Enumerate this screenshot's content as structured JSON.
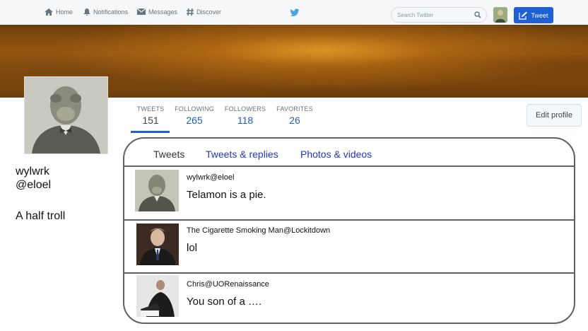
{
  "nav": {
    "items": [
      {
        "label": "Home",
        "icon": "home-icon"
      },
      {
        "label": "Notifications",
        "icon": "bell-icon"
      },
      {
        "label": "Messages",
        "icon": "envelope-icon"
      },
      {
        "label": "Discover",
        "icon": "hashtag-icon"
      }
    ],
    "logo_icon": "twitter-bird-icon",
    "search_placeholder": "Search Twitter",
    "tweet_button": "Tweet",
    "accent": "#1f60d6"
  },
  "profile": {
    "name": "wylwrk",
    "handle": "@eloel",
    "bio": "A half troll",
    "edit_button": "Edit profile"
  },
  "stats": [
    {
      "label": "TWEETS",
      "value": "151"
    },
    {
      "label": "FOLLOWING",
      "value": "265"
    },
    {
      "label": "FOLLOWERS",
      "value": "118"
    },
    {
      "label": "FAVORITES",
      "value": "26"
    }
  ],
  "tabs": [
    "Tweets",
    "Tweets & replies",
    "Photos & videos"
  ],
  "tweets": [
    {
      "user": "wylwrk@eloel",
      "text": "Telamon is a pie."
    },
    {
      "user": "The Cigarette Smoking Man@Lockitdown",
      "text": "lol"
    },
    {
      "user": "Chris@UORenaissance",
      "text": "You son of a …."
    }
  ]
}
